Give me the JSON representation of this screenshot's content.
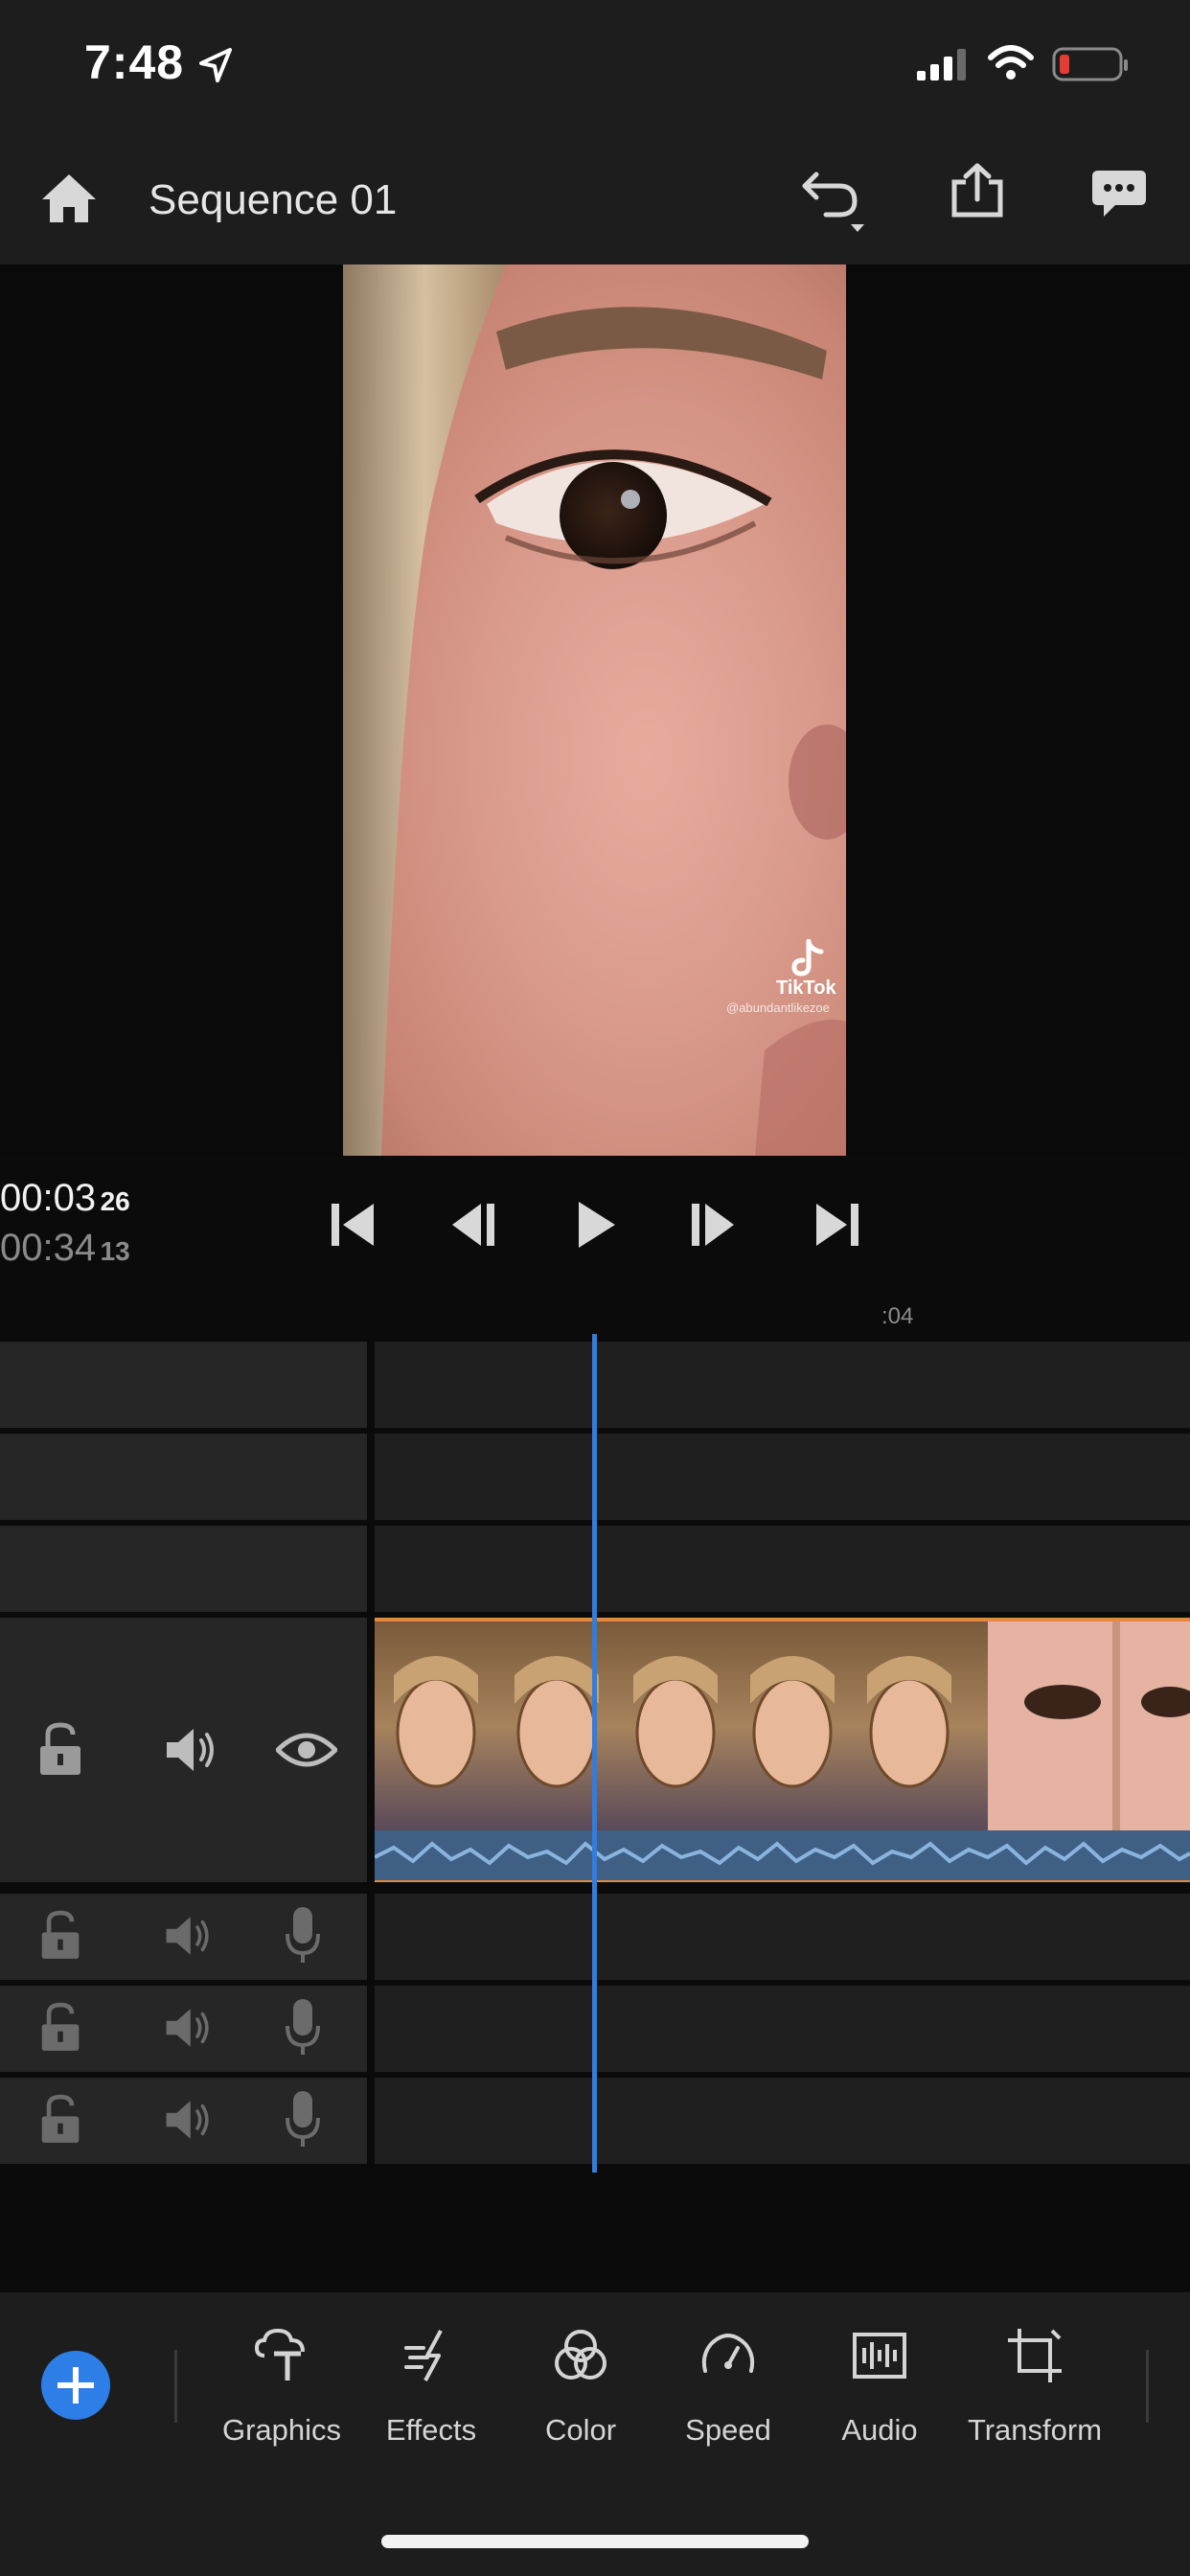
{
  "status_bar": {
    "time": "7:48"
  },
  "header": {
    "title": "Sequence 01"
  },
  "preview": {
    "watermark_brand": "TikTok",
    "watermark_user": "@abundantlikezoe"
  },
  "transport": {
    "current_time_main": "00:03",
    "current_time_frames": "26",
    "duration_main": "00:34",
    "duration_frames": "13"
  },
  "timeline": {
    "ruler_label": ":04",
    "playhead_position_seconds": 3.87
  },
  "toolbar": {
    "items": [
      {
        "label": "Graphics",
        "icon": "graphics-icon"
      },
      {
        "label": "Effects",
        "icon": "effects-icon"
      },
      {
        "label": "Color",
        "icon": "color-icon"
      },
      {
        "label": "Speed",
        "icon": "speed-icon"
      },
      {
        "label": "Audio",
        "icon": "audio-icon"
      },
      {
        "label": "Transform",
        "icon": "transform-icon"
      }
    ]
  },
  "colors": {
    "accent": "#2f7de1",
    "clip_border": "#e8883a",
    "waveform": "#5a8ab8",
    "background": "#1d1d1d"
  }
}
